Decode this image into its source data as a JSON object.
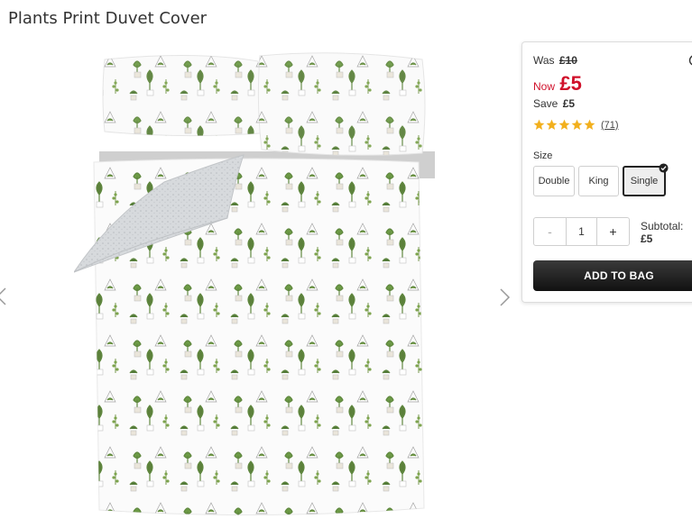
{
  "product": {
    "title": "Plants Print Duvet Cover"
  },
  "pricing": {
    "was_label": "Was",
    "was_price": "£10",
    "now_label": "Now",
    "now_price": "£5",
    "save_label": "Save",
    "save_amount": "£5",
    "rating_stars": 5,
    "review_count": "(71)"
  },
  "size": {
    "label": "Size",
    "options": [
      "Double",
      "King",
      "Single"
    ],
    "selected": "Single"
  },
  "quantity": {
    "minus": "-",
    "value": "1",
    "plus": "+"
  },
  "subtotal": {
    "label": "Subtotal:",
    "value": "£5"
  },
  "cta": {
    "add_to_bag": "ADD TO BAG"
  },
  "colors": {
    "price_red": "#d0102a",
    "star_gold": "#f2b01e",
    "button_dark": "#111111",
    "plant_green": "#4e7a2a"
  }
}
